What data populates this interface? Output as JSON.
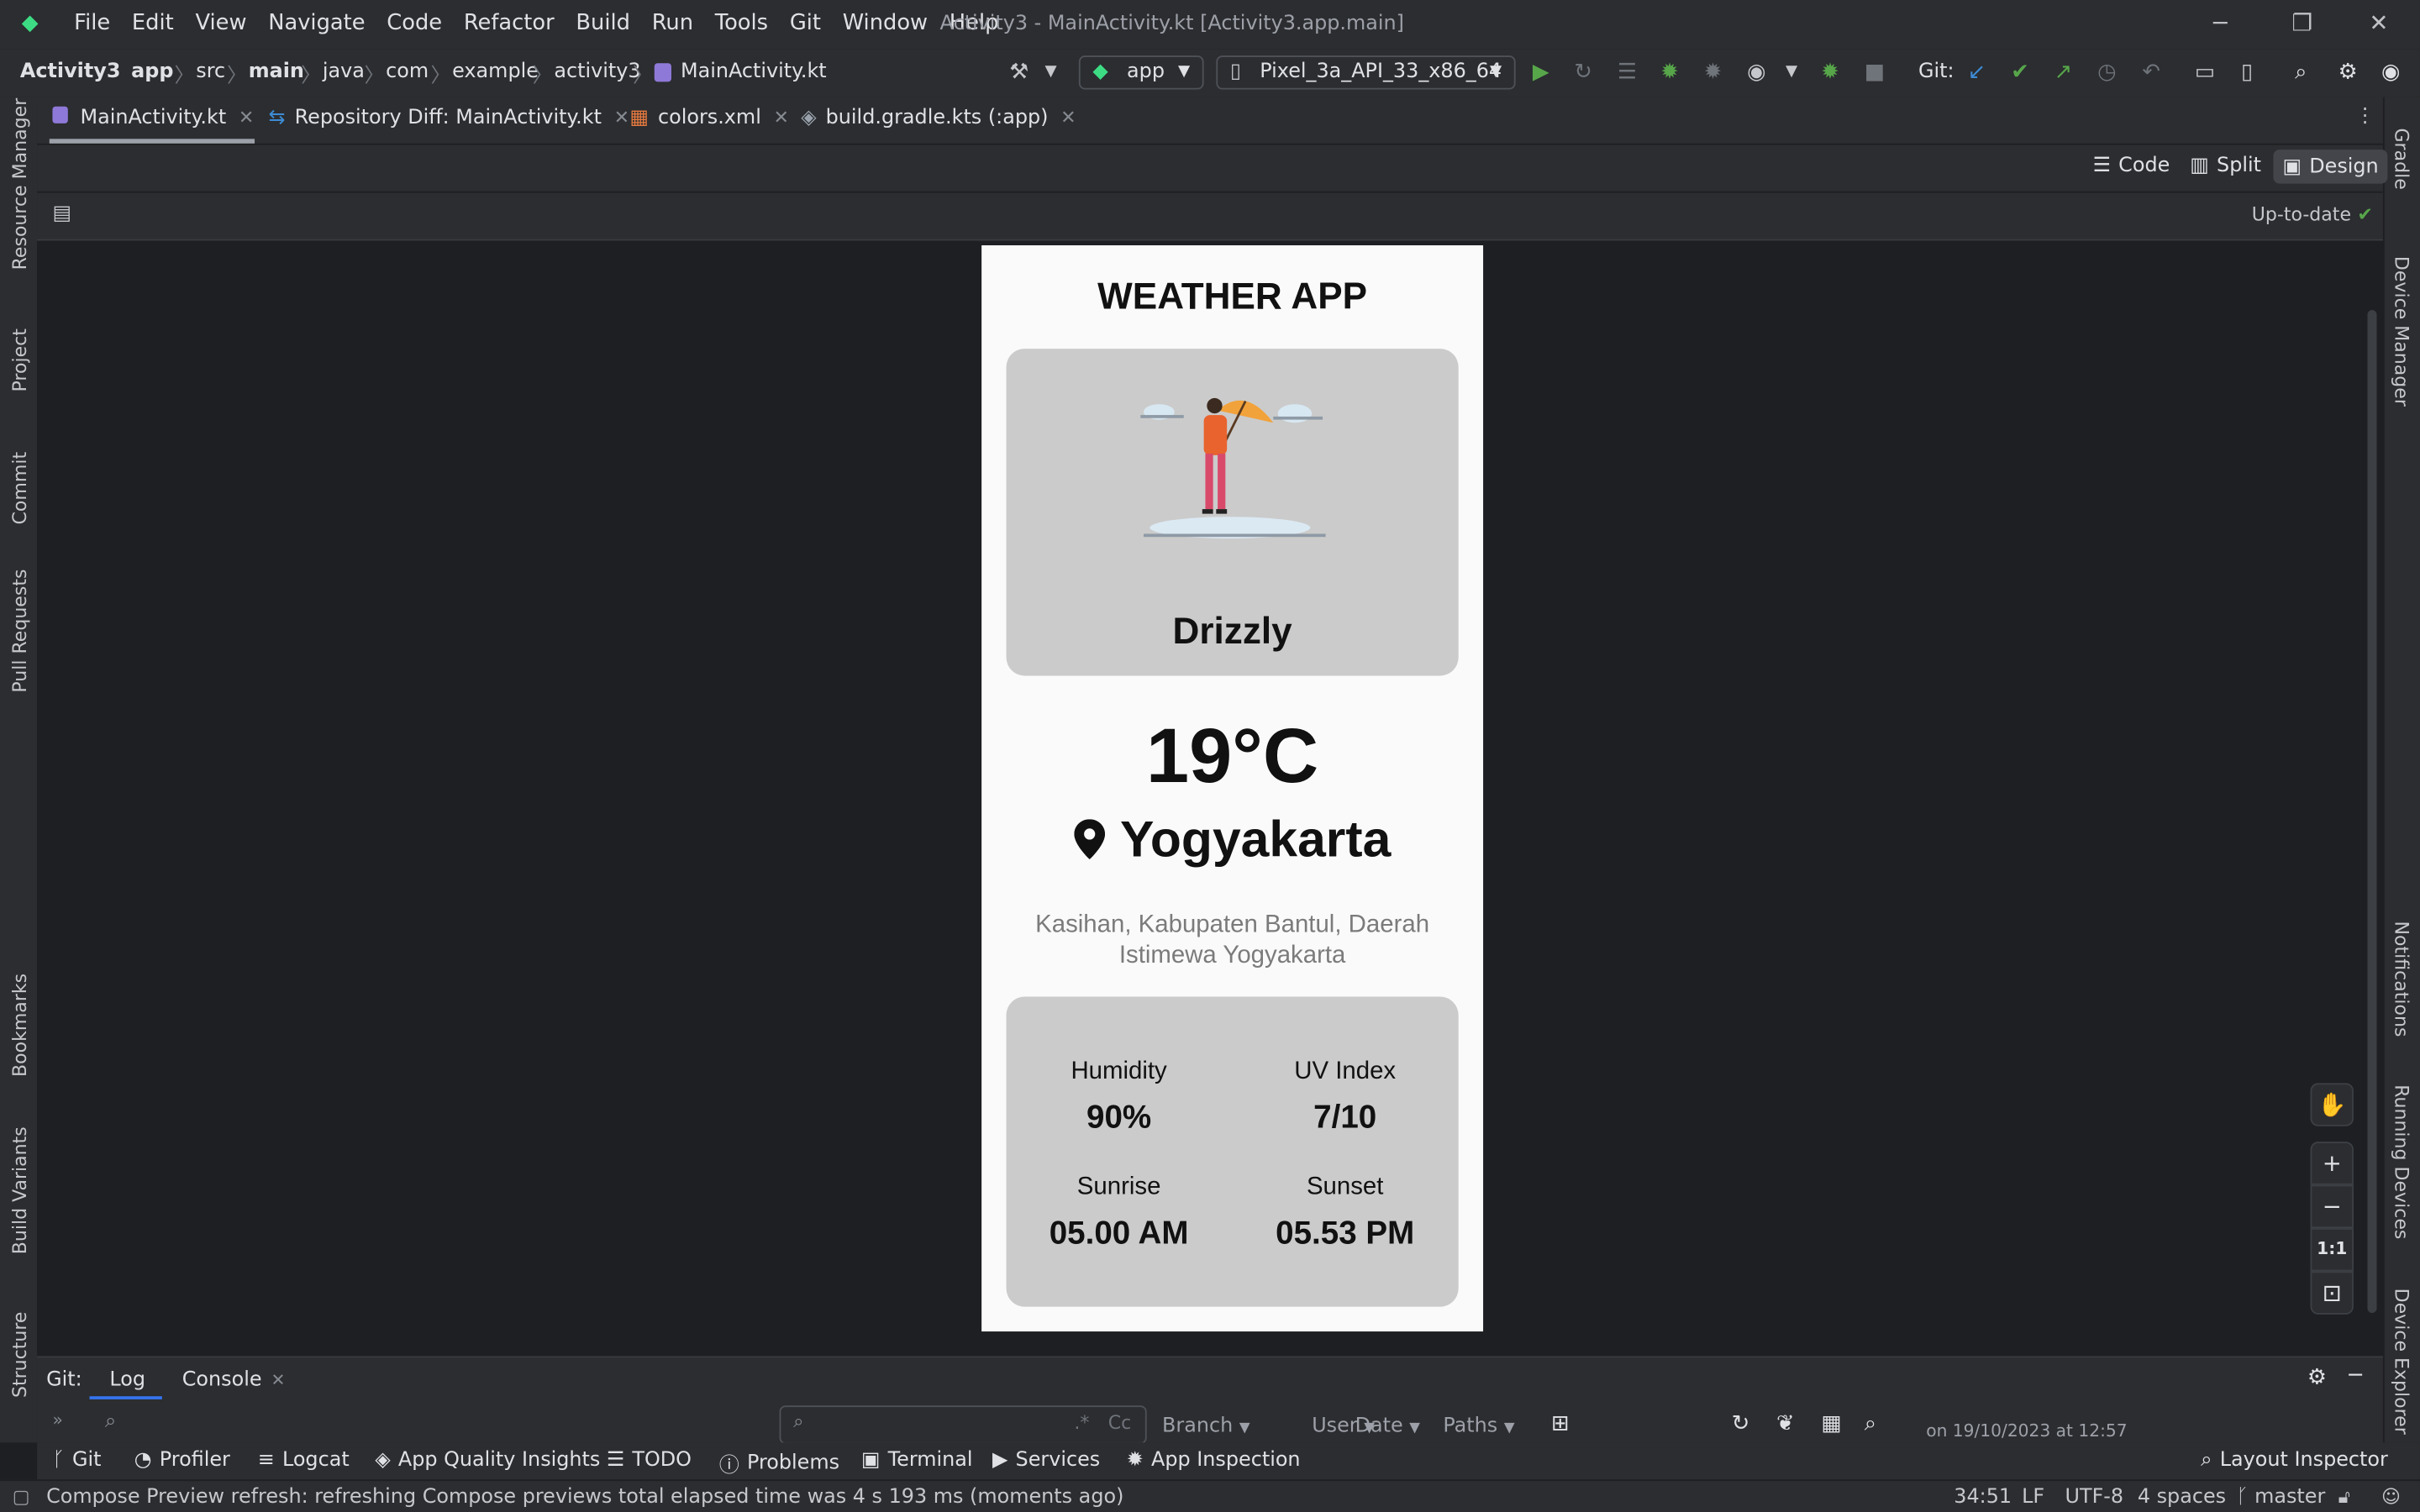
{
  "window": {
    "title": "Activity3 - MainActivity.kt [Activity3.app.main]",
    "menu": [
      "File",
      "Edit",
      "View",
      "Navigate",
      "Code",
      "Refactor",
      "Build",
      "Run",
      "Tools",
      "Git",
      "Window",
      "Help"
    ]
  },
  "breadcrumb": [
    "Activity3",
    "app",
    "src",
    "main",
    "java",
    "com",
    "example",
    "activity3",
    "MainActivity.kt"
  ],
  "toolbar": {
    "config": "app",
    "device": "Pixel_3a_API_33_x86_64",
    "git_label": "Git:"
  },
  "tabs": [
    "MainActivity.kt",
    "Repository Diff: MainActivity.kt",
    "colors.xml",
    "build.gradle.kts (:app)"
  ],
  "view_modes": [
    "Code",
    "Split",
    "Design"
  ],
  "preview_status": "Up-to-date",
  "left_tools": [
    "Resource Manager",
    "Project",
    "Commit",
    "Pull Requests",
    "Bookmarks",
    "Build Variants",
    "Structure"
  ],
  "right_tools": [
    "Gradle",
    "Device Manager",
    "Notifications",
    "Running Devices",
    "Device Explorer"
  ],
  "app": {
    "title": "WEATHER APP",
    "condition": "Drizzly",
    "temperature": "19°C",
    "city": "Yogyakarta",
    "address": "Kasihan, Kabupaten Bantul, Daerah Istimewa Yogyakarta",
    "stats": [
      {
        "label": "Humidity",
        "value": "90%"
      },
      {
        "label": "UV Index",
        "value": "7/10"
      },
      {
        "label": "Sunrise",
        "value": "05.00 AM"
      },
      {
        "label": "Sunset",
        "value": "05.53 PM"
      }
    ]
  },
  "zoom": {
    "reset_label": "1:1"
  },
  "git_panel": {
    "prefix": "Git:",
    "tabs": [
      "Log",
      "Console"
    ],
    "filters": [
      "Branch",
      "User",
      "Date",
      "Paths"
    ],
    "log_entry": "on 19/10/2023 at 12:57"
  },
  "tool_windows": [
    "Git",
    "Profiler",
    "Logcat",
    "App Quality Insights",
    "TODO",
    "Problems",
    "Terminal",
    "Services",
    "App Inspection"
  ],
  "layout_inspector": "Layout Inspector",
  "status": {
    "message": "Compose Preview refresh: refreshing Compose previews total elapsed time was 4 s 193 ms (moments ago)",
    "position": "34:51",
    "line_sep": "LF",
    "encoding": "UTF-8",
    "indent": "4 spaces",
    "branch": "master"
  }
}
